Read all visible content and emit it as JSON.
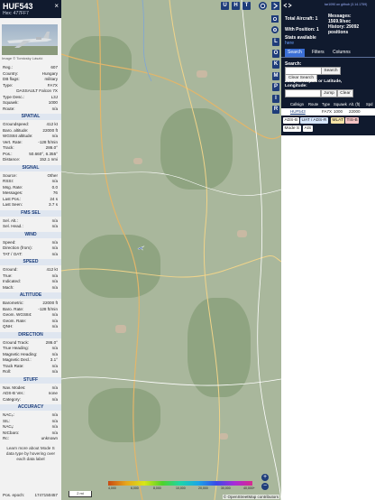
{
  "selected": {
    "callsign": "HUF543",
    "hex_line": "Hex: 477FF7",
    "close_label": "×",
    "photo_credit": "Image © Tomicsky László"
  },
  "details_rows": [
    {
      "k": "Reg.:",
      "v": "607"
    },
    {
      "k": "Country:",
      "v": "Hungary"
    },
    {
      "k": "DB flags:",
      "v": "military"
    },
    {
      "k": "Type:",
      "v": "FA7X"
    },
    {
      "k": "",
      "v": "DASSAULT Falcon 7X"
    },
    {
      "k": "Type Desc.:",
      "v": "L3J"
    },
    {
      "k": "Squawk:",
      "v": "1000"
    },
    {
      "k": "Route:",
      "v": "n/a"
    }
  ],
  "sections": [
    {
      "title": "SPATIAL",
      "rows": [
        {
          "k": "Groundspeed:",
          "v": "412 kt"
        },
        {
          "k": "Baro. altitude:",
          "v": "22000 ft"
        },
        {
          "k": "WGS84 altitude:",
          "v": "n/a"
        },
        {
          "k": "Vert. Rate:",
          "v": "-128 ft/min"
        },
        {
          "k": "Track:",
          "v": "286.0°"
        },
        {
          "k": "Pos.:",
          "v": "50.660°, 6.355°"
        },
        {
          "k": "Distance:",
          "v": "152.1 nmi"
        }
      ]
    },
    {
      "title": "SIGNAL",
      "rows": [
        {
          "k": "Source:",
          "v": "Other"
        },
        {
          "k": "RSSI:",
          "v": "n/a"
        },
        {
          "k": "Msg. Rate:",
          "v": "0.0"
        },
        {
          "k": "Messages:",
          "v": "76"
        },
        {
          "k": "Last Pos.:",
          "v": "24 s"
        },
        {
          "k": "Last Seen:",
          "v": "3.7 s"
        }
      ]
    },
    {
      "title": "FMS SEL",
      "rows": [
        {
          "k": "Sel. Alt.:",
          "v": "n/a"
        },
        {
          "k": "Sel. Head.:",
          "v": "n/a"
        }
      ]
    },
    {
      "title": "WIND",
      "rows": [
        {
          "k": "Speed:",
          "v": "n/a"
        },
        {
          "k": "Direction (from):",
          "v": "n/a"
        },
        {
          "k": "TAT / OAT:",
          "v": "n/a"
        }
      ]
    },
    {
      "title": "SPEED",
      "rows": [
        {
          "k": "Ground:",
          "v": "412 kt"
        },
        {
          "k": "True:",
          "v": "n/a"
        },
        {
          "k": "Indicated:",
          "v": "n/a"
        },
        {
          "k": "Mach:",
          "v": "n/a"
        }
      ]
    },
    {
      "title": "ALTITUDE",
      "rows": [
        {
          "k": "Barometric:",
          "v": "22000 ft"
        },
        {
          "k": "Baro. Rate:",
          "v": "-128 ft/min"
        },
        {
          "k": "Geom. WGS84:",
          "v": "n/a"
        },
        {
          "k": "Geom. Rate:",
          "v": "n/a"
        },
        {
          "k": "QNH:",
          "v": "n/a"
        }
      ]
    },
    {
      "title": "DIRECTION",
      "rows": [
        {
          "k": "Ground Track:",
          "v": "286.0°"
        },
        {
          "k": "True Heading:",
          "v": "n/a"
        },
        {
          "k": "Magnetic Heading:",
          "v": "n/a"
        },
        {
          "k": "Magnetic Decl.:",
          "v": "3.1°"
        },
        {
          "k": "Track Rate:",
          "v": "n/a"
        },
        {
          "k": "Roll:",
          "v": "n/a"
        }
      ]
    },
    {
      "title": "STUFF",
      "rows": [
        {
          "k": "Nav. Modes:",
          "v": "n/a"
        },
        {
          "k": "ADS-B Ver.:",
          "v": "none"
        },
        {
          "k": "Category:",
          "v": "n/a"
        }
      ]
    },
    {
      "title": "ACCURACY",
      "rows": [
        {
          "k": "NACₚ:",
          "v": "n/a"
        },
        {
          "k": "SIL:",
          "v": "n/a"
        },
        {
          "k": "NACᵥ:",
          "v": "n/a"
        },
        {
          "k": "NICbaro:",
          "v": "n/a"
        },
        {
          "k": "Rc:",
          "v": "unknown"
        }
      ]
    }
  ],
  "note": "Learn more about Mode S data type by hovering over each data label",
  "pos_epoch": {
    "k": "Pos. epoch:",
    "v": "1747150457"
  },
  "map": {
    "top_buttons": [
      "U",
      "H",
      "T"
    ],
    "side_buttons": [
      "L",
      "O",
      "K",
      "M",
      "P",
      "I",
      "R"
    ],
    "zoom_in": "+",
    "zoom_out": "−",
    "scale": "2 mi",
    "attribution": "© OpenStreetMap contributors",
    "altitude_ticks": [
      "4,000",
      "6,000",
      "8,000",
      "10,000",
      "20,000",
      "30,000",
      "40,000+"
    ]
  },
  "stats": {
    "github_link": "tar1090 on github (3.14.1759)",
    "total_aircraft": "Total Aircraft: 1",
    "with_position": "With Position: 1",
    "messages": "Messages: 1569.9/sec",
    "history": "History: 29092 positions",
    "stats_available": "Stats available",
    "stats_link": "here"
  },
  "tabs": [
    "Search",
    "Filters",
    "Columns"
  ],
  "search": {
    "label": "Search:",
    "button": "Search",
    "clear_search": "Clear Search",
    "jump_label": "Jump to Airport or Latitude, Longitude:",
    "jump_button": "Jump",
    "clear_button": "Clear"
  },
  "table": {
    "headers": [
      "Callsign",
      "Route",
      "Type",
      "Squawk",
      "Alt. (ft)",
      "Spd"
    ],
    "row": [
      "HUF543",
      "",
      "FA7X",
      "1000",
      "22000",
      ""
    ]
  },
  "legend": [
    "ADS-B",
    "UAT / ADS-R",
    "MLAT",
    "TIS-B",
    "Mode S",
    "AIS"
  ]
}
